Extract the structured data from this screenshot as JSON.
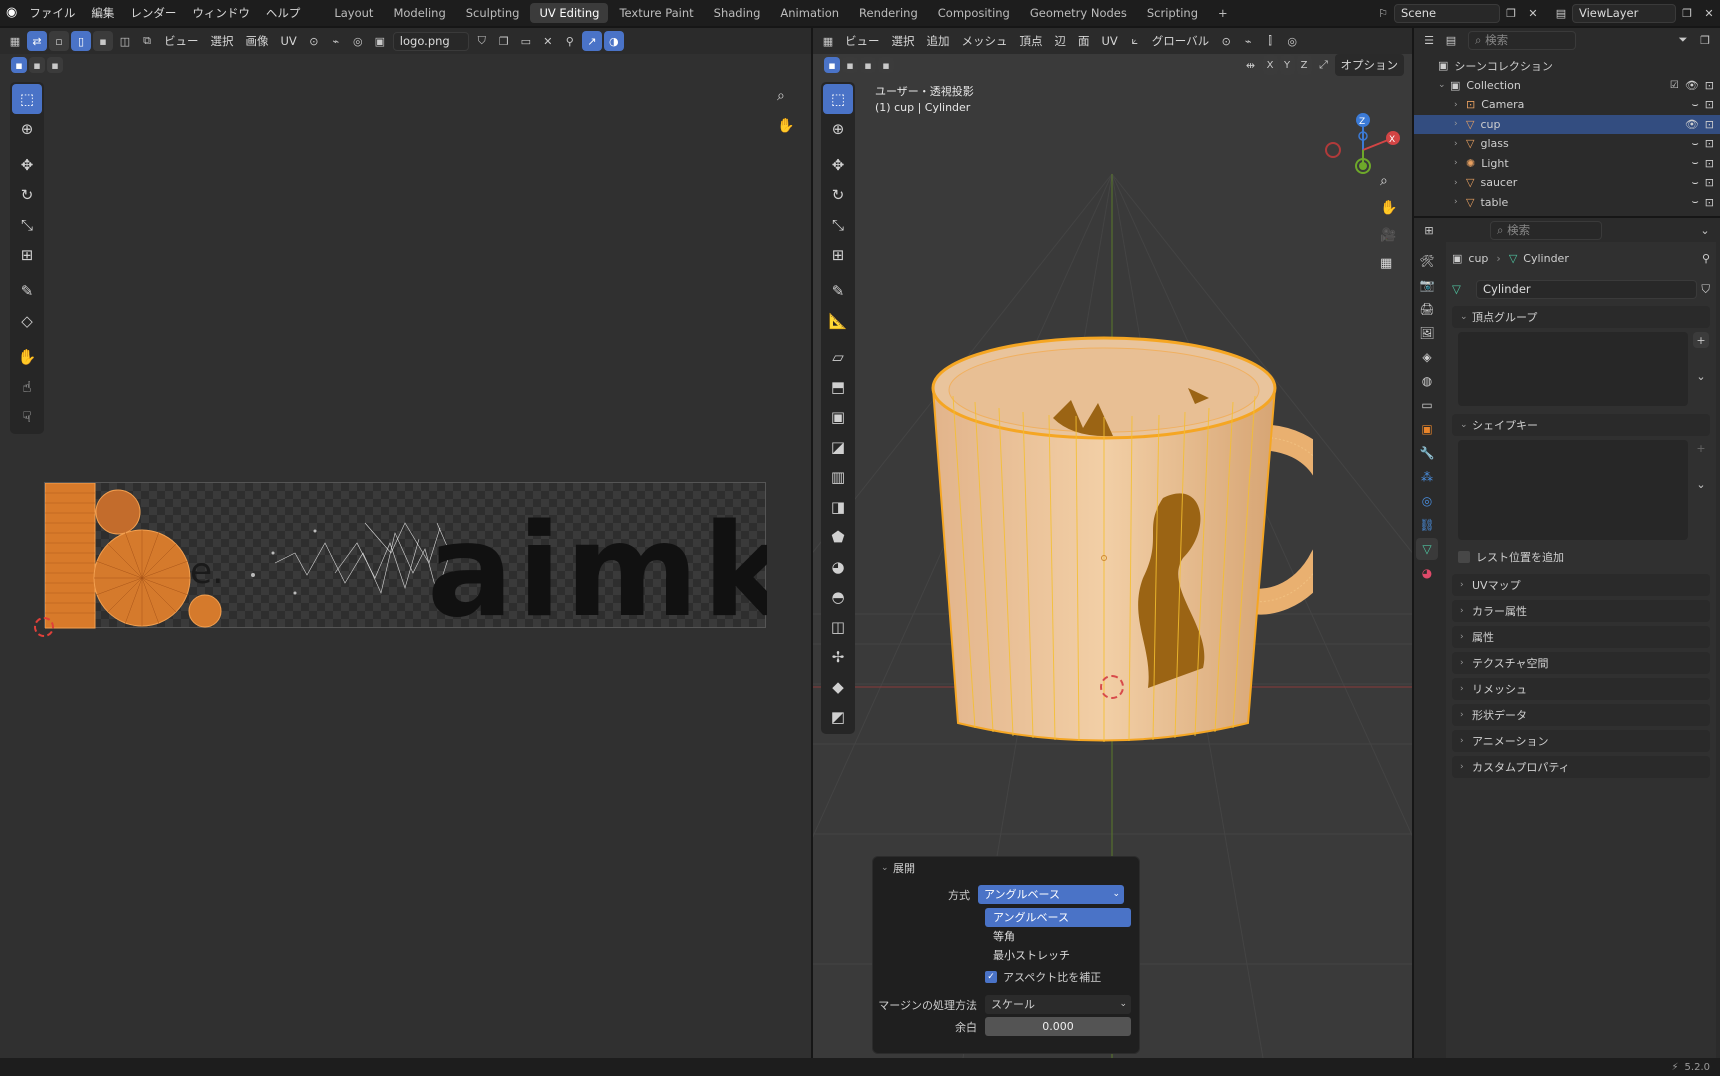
{
  "menubar": {
    "items": [
      "ファイル",
      "編集",
      "レンダー",
      "ウィンドウ",
      "ヘルプ"
    ]
  },
  "workspaces": {
    "tabs": [
      "Layout",
      "Modeling",
      "Sculpting",
      "UV Editing",
      "Texture Paint",
      "Shading",
      "Animation",
      "Rendering",
      "Compositing",
      "Geometry Nodes",
      "Scripting"
    ],
    "active": "UV Editing",
    "add": "+"
  },
  "scene": {
    "label": "Scene",
    "viewlayer": "ViewLayer"
  },
  "uv_editor": {
    "menus": [
      "ビュー",
      "選択",
      "画像",
      "UV"
    ],
    "image_name": "logo.png",
    "logo_text": "aimk",
    "logo_small": "e."
  },
  "viewport": {
    "menus": [
      "ビュー",
      "選択",
      "追加",
      "メッシュ",
      "頂点",
      "辺",
      "面",
      "UV"
    ],
    "orientation": "グローバル",
    "options": "オプション",
    "view_name": "ユーザー・透視投影",
    "object_info": "(1) cup | Cylinder",
    "axes": {
      "x": "X",
      "y": "Y",
      "z": "Z"
    }
  },
  "unwrap_panel": {
    "title": "展開",
    "method_label": "方式",
    "method_value": "アングルベース",
    "options": [
      "アングルベース",
      "等角",
      "最小ストレッチ"
    ],
    "selected_option": "アングルベース",
    "aspect_label": "アスペクト比を補正",
    "aspect_checked": true,
    "margin_method_label": "マージンの処理方法",
    "margin_method_value": "スケール",
    "margin_label": "余白",
    "margin_value": "0.000"
  },
  "outliner": {
    "search_placeholder": "検索",
    "scene_collection": "シーンコレクション",
    "collection": "Collection",
    "objects": [
      {
        "name": "Camera",
        "selected": false
      },
      {
        "name": "cup",
        "selected": true
      },
      {
        "name": "glass",
        "selected": false
      },
      {
        "name": "Light",
        "selected": false
      },
      {
        "name": "saucer",
        "selected": false
      },
      {
        "name": "table",
        "selected": false
      }
    ]
  },
  "properties": {
    "search_placeholder": "検索",
    "breadcrumb_object": "cup",
    "breadcrumb_data": "Cylinder",
    "mesh_name": "Cylinder",
    "vertex_groups": "頂点グループ",
    "shape_keys": "シェイプキー",
    "relative_label": "レスト位置を追加",
    "collapsed": [
      "UVマップ",
      "カラー属性",
      "属性",
      "テクスチャ空間",
      "リメッシュ",
      "形状データ",
      "アニメーション",
      "カスタムプロパティ"
    ]
  },
  "status": {
    "version": "5.2.0"
  },
  "colors": {
    "accent": "#4a73c7",
    "orange": "#e8842a",
    "selected_row": "#334d80"
  }
}
